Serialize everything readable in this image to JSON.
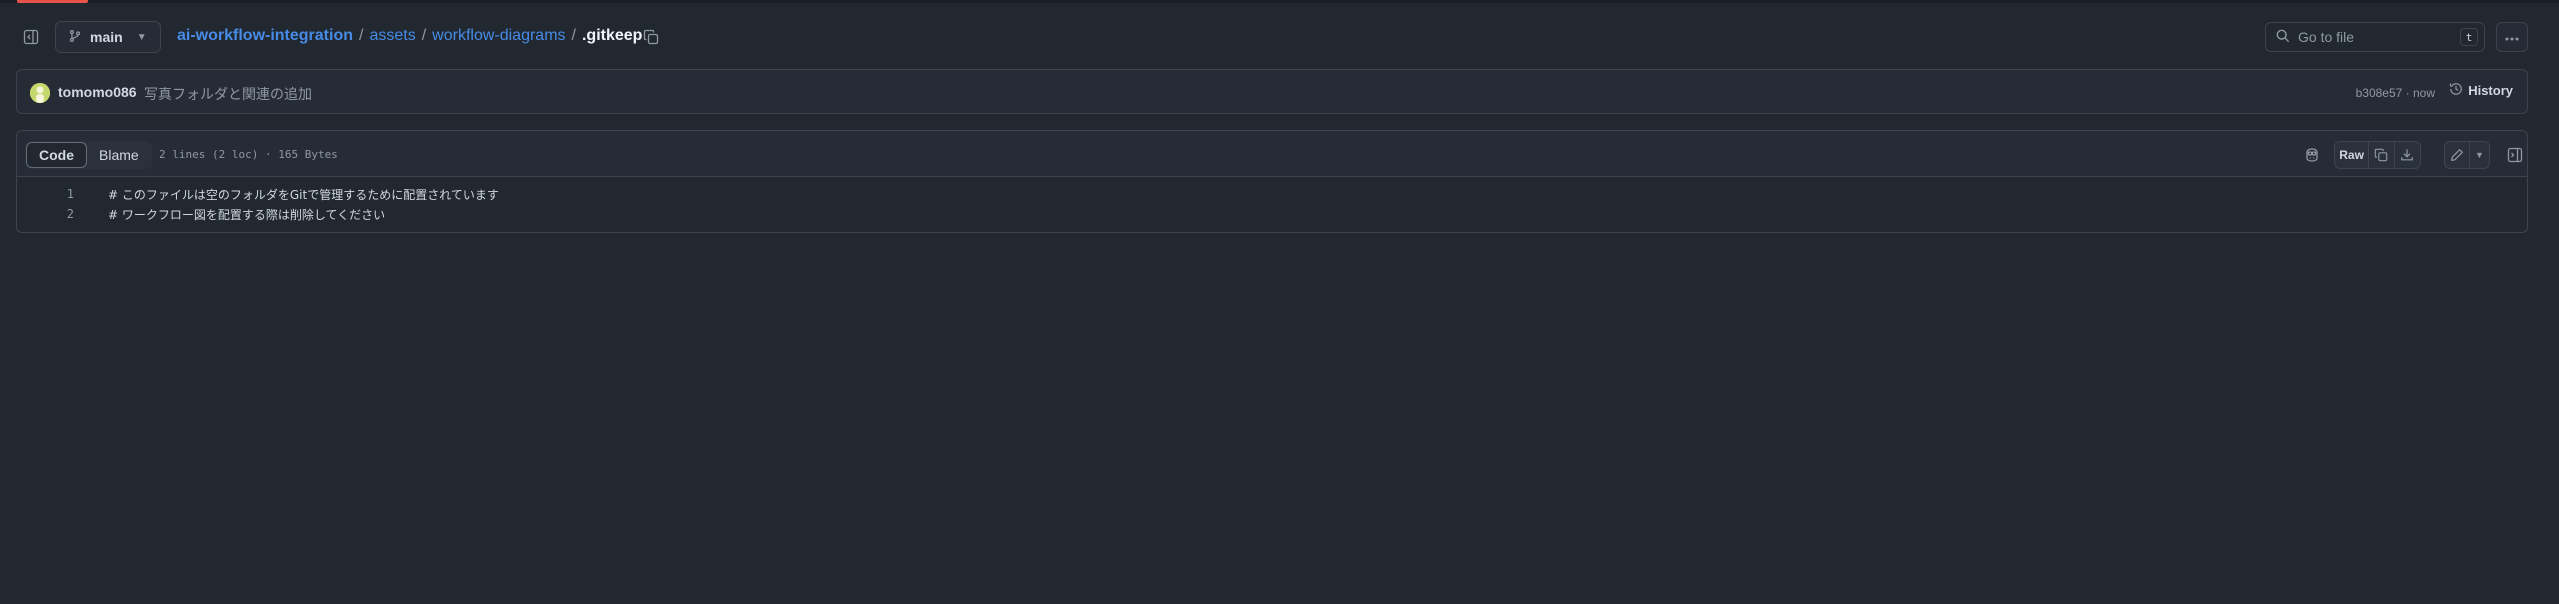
{
  "header": {
    "branch": "main",
    "breadcrumb": {
      "repo": "ai-workflow-integration",
      "dir1": "assets",
      "dir2": "workflow-diagrams",
      "file": ".gitkeep",
      "separator": "/"
    },
    "goto_file": {
      "placeholder": "Go to file",
      "shortcut": "t"
    }
  },
  "commit": {
    "author": "tomomo086",
    "message": "写真フォルダと関連の追加",
    "meta": "b308e57 · now",
    "history_label": "History"
  },
  "file": {
    "tabs": [
      {
        "label": "Code",
        "active": true
      },
      {
        "label": "Blame",
        "active": false
      }
    ],
    "info": "2 lines (2 loc) · 165 Bytes",
    "toolbar": {
      "raw_label": "Raw"
    },
    "lines": [
      {
        "number": "1",
        "text": "# このファイルは空のフォルダをGitで管理するために配置されています"
      },
      {
        "number": "2",
        "text": "# ワークフロー図を配置する際は削除してください"
      }
    ]
  },
  "colors": {
    "background": "#212830",
    "link": "#478be6",
    "accent_bar": "#e5534b",
    "border": "#3d444d"
  },
  "icons": [
    "sidebar-toggle-icon",
    "git-branch-icon",
    "copy-icon",
    "search-icon",
    "kebab-icon",
    "history-icon",
    "copilot-icon",
    "download-icon",
    "pencil-icon",
    "chevron-down-icon",
    "symbols-icon"
  ]
}
